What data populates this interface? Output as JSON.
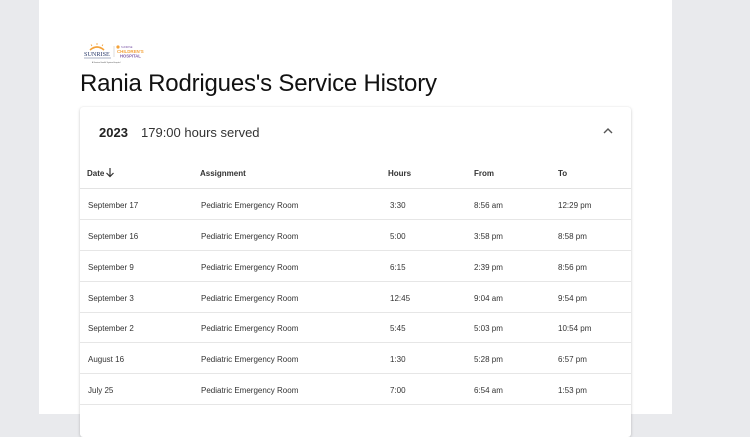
{
  "logo": {
    "brand": "SUNRISE",
    "sub_brand": "CHILDREN'S HOSPITAL",
    "tagline": "A Sunrise Health System Hospital"
  },
  "page_title": "Rania Rodrigues's Service History",
  "year_group": {
    "year": "2023",
    "hours_served": "179:00 hours served"
  },
  "table": {
    "columns": [
      "Date",
      "Assignment",
      "Hours",
      "From",
      "To"
    ],
    "sort_column": "Date",
    "sort_direction": "descending",
    "rows": [
      {
        "date": "September 17",
        "assignment": "Pediatric Emergency Room",
        "hours": "3:30",
        "from": "8:56 am",
        "to": "12:29 pm"
      },
      {
        "date": "September 16",
        "assignment": "Pediatric Emergency Room",
        "hours": "5:00",
        "from": "3:58 pm",
        "to": "8:58 pm"
      },
      {
        "date": "September 9",
        "assignment": "Pediatric Emergency Room",
        "hours": "6:15",
        "from": "2:39 pm",
        "to": "8:56 pm"
      },
      {
        "date": "September 3",
        "assignment": "Pediatric Emergency Room",
        "hours": "12:45",
        "from": "9:04 am",
        "to": "9:54 pm"
      },
      {
        "date": "September 2",
        "assignment": "Pediatric Emergency Room",
        "hours": "5:45",
        "from": "5:03 pm",
        "to": "10:54 pm"
      },
      {
        "date": "August 16",
        "assignment": "Pediatric Emergency Room",
        "hours": "1:30",
        "from": "5:28 pm",
        "to": "6:57 pm"
      },
      {
        "date": "July 25",
        "assignment": "Pediatric Emergency Room",
        "hours": "7:00",
        "from": "6:54 am",
        "to": "1:53 pm"
      }
    ]
  },
  "colors": {
    "background": "#e9eaed",
    "card": "#ffffff",
    "logo_orange": "#f4a23a",
    "logo_purple": "#7e5aa8",
    "logo_navy": "#2b3b6b"
  }
}
